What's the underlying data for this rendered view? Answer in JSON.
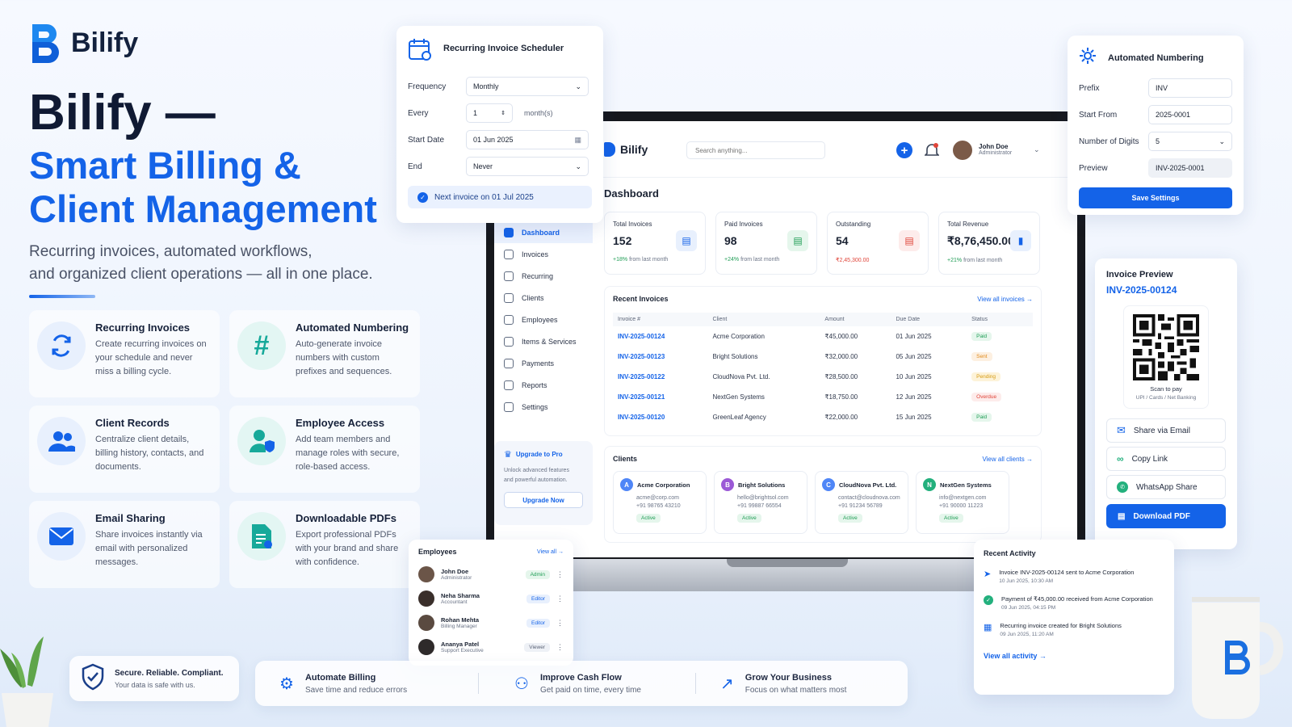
{
  "brand": {
    "name": "Bilify",
    "logo_letter": "B"
  },
  "hero": {
    "title": "Bilify —",
    "subtitle_line1": "Smart Billing &",
    "subtitle_line2": "Client Management",
    "desc_line1": "Recurring invoices, automated workflows,",
    "desc_line2": "and organized client operations — all in one place."
  },
  "features": [
    {
      "icon": "refresh-icon",
      "title": "Recurring Invoices",
      "desc": "Create recurring invoices on your schedule and never miss a billing cycle."
    },
    {
      "icon": "hash-icon",
      "title": "Automated Numbering",
      "desc": "Auto-generate invoice numbers with custom prefixes and sequences."
    },
    {
      "icon": "users-icon",
      "title": "Client Records",
      "desc": "Centralize client details, billing history, contacts, and documents."
    },
    {
      "icon": "user-shield-icon",
      "title": "Employee Access",
      "desc": "Add team members and manage roles with secure, role-based access."
    },
    {
      "icon": "mail-icon",
      "title": "Email Sharing",
      "desc": "Share invoices instantly via email with personalized messages."
    },
    {
      "icon": "pdf-icon",
      "title": "Downloadable PDFs",
      "desc": "Export professional PDFs with your brand and share with confidence."
    }
  ],
  "scheduler": {
    "title": "Recurring Invoice Scheduler",
    "frequency_label": "Frequency",
    "frequency_value": "Monthly",
    "every_label": "Every",
    "every_value": "1",
    "every_unit": "month(s)",
    "start_label": "Start Date",
    "start_value": "01 Jun 2025",
    "end_label": "End",
    "end_value": "Never",
    "next_note": "Next invoice on 01 Jul 2025"
  },
  "app": {
    "name": "Bilify",
    "search_placeholder": "Search anything...",
    "user_name": "John Doe",
    "user_role": "Administrator",
    "page_title": "Dashboard",
    "sidebar": [
      "Dashboard",
      "Invoices",
      "Recurring",
      "Clients",
      "Employees",
      "Items & Services",
      "Payments",
      "Reports",
      "Settings"
    ],
    "upgrade": {
      "title": "Upgrade to Pro",
      "desc_line1": "Unlock advanced features",
      "desc_line2": "and powerful automation.",
      "button": "Upgrade Now"
    },
    "stats": [
      {
        "title": "Total Invoices",
        "value": "152",
        "change": "+18%",
        "change_note": "from last month",
        "color": "#1463e8",
        "bg": "#e8f0fd"
      },
      {
        "title": "Paid Invoices",
        "value": "98",
        "change": "+24%",
        "change_note": "from last month",
        "color": "#1f9d55",
        "bg": "#e5f6ec"
      },
      {
        "title": "Outstanding",
        "value": "54",
        "change": "₹2,45,300.00",
        "change_note": "",
        "color": "#e0453a",
        "bg": "#fdeceb"
      },
      {
        "title": "Total Revenue",
        "value": "₹8,76,450.00",
        "change": "+21%",
        "change_note": "from last month",
        "color": "#1463e8",
        "bg": "#e8f0fd"
      }
    ],
    "recent_invoices": {
      "title": "Recent Invoices",
      "view_all": "View all invoices →",
      "headers": [
        "Invoice #",
        "Client",
        "Amount",
        "Due Date",
        "Status"
      ],
      "rows": [
        [
          "INV-2025-00124",
          "Acme Corporation",
          "₹45,000.00",
          "01 Jun 2025",
          "Paid"
        ],
        [
          "INV-2025-00123",
          "Bright Solutions",
          "₹32,000.00",
          "05 Jun 2025",
          "Sent"
        ],
        [
          "INV-2025-00122",
          "CloudNova Pvt. Ltd.",
          "₹28,500.00",
          "10 Jun 2025",
          "Pending"
        ],
        [
          "INV-2025-00121",
          "NextGen Systems",
          "₹18,750.00",
          "12 Jun 2025",
          "Overdue"
        ],
        [
          "INV-2025-00120",
          "GreenLeaf Agency",
          "₹22,000.00",
          "15 Jun 2025",
          "Paid"
        ]
      ]
    },
    "clients": {
      "title": "Clients",
      "view_all": "View all clients →",
      "items": [
        {
          "initial": "A",
          "name": "Acme Corporation",
          "email": "acme@corp.com",
          "phone": "+91 98765 43210",
          "status": "Active",
          "color": "#4f86f7"
        },
        {
          "initial": "B",
          "name": "Bright Solutions",
          "email": "hello@brightsol.com",
          "phone": "+91 99887 66554",
          "status": "Active",
          "color": "#9b59d6"
        },
        {
          "initial": "C",
          "name": "CloudNova Pvt. Ltd.",
          "email": "contact@cloudnova.com",
          "phone": "+91 91234 56789",
          "status": "Active",
          "color": "#4f86f7"
        },
        {
          "initial": "N",
          "name": "NextGen Systems",
          "email": "info@nextgen.com",
          "phone": "+91 90000 11223",
          "status": "Active",
          "color": "#23b07d"
        }
      ]
    }
  },
  "numbering": {
    "title": "Automated Numbering",
    "prefix_label": "Prefix",
    "prefix_value": "INV",
    "start_label": "Start From",
    "start_value": "2025-0001",
    "digits_label": "Number of Digits",
    "digits_value": "5",
    "preview_label": "Preview",
    "preview_value": "INV-2025-0001",
    "save": "Save Settings"
  },
  "preview": {
    "title": "Invoice Preview",
    "number": "INV-2025-00124",
    "scan_text": "Scan to pay",
    "scan_sub": "UPI / Cards / Net Banking",
    "share_email": "Share via Email",
    "copy_link": "Copy Link",
    "whatsapp": "WhatsApp Share",
    "download": "Download PDF"
  },
  "employees": {
    "title": "Employees",
    "view_all": "View all →",
    "items": [
      {
        "name": "John Doe",
        "role": "Administrator",
        "badge": "Admin"
      },
      {
        "name": "Neha Sharma",
        "role": "Accountant",
        "badge": "Editor"
      },
      {
        "name": "Rohan Mehta",
        "role": "Billing Manager",
        "badge": "Editor"
      },
      {
        "name": "Ananya Patel",
        "role": "Support Executive",
        "badge": "Viewer"
      }
    ]
  },
  "activity": {
    "title": "Recent Activity",
    "view_all": "View all activity →",
    "items": [
      {
        "text": "Invoice INV-2025-00124 sent to Acme Corporation",
        "time": "10 Jun 2025, 10:30 AM"
      },
      {
        "text": "Payment of ₹45,000.00 received from Acme Corporation",
        "time": "09 Jun 2025, 04:15 PM"
      },
      {
        "text": "Recurring invoice created for Bright Solutions",
        "time": "09 Jun 2025, 11:20 AM"
      }
    ]
  },
  "bottom": {
    "secure_title": "Secure. Reliable. Compliant.",
    "secure_sub": "Your data is safe with us.",
    "items": [
      {
        "title": "Automate Billing",
        "sub": "Save time and reduce errors"
      },
      {
        "title": "Improve Cash Flow",
        "sub": "Get paid on time, every time"
      },
      {
        "title": "Grow Your Business",
        "sub": "Focus on what matters most"
      }
    ]
  }
}
